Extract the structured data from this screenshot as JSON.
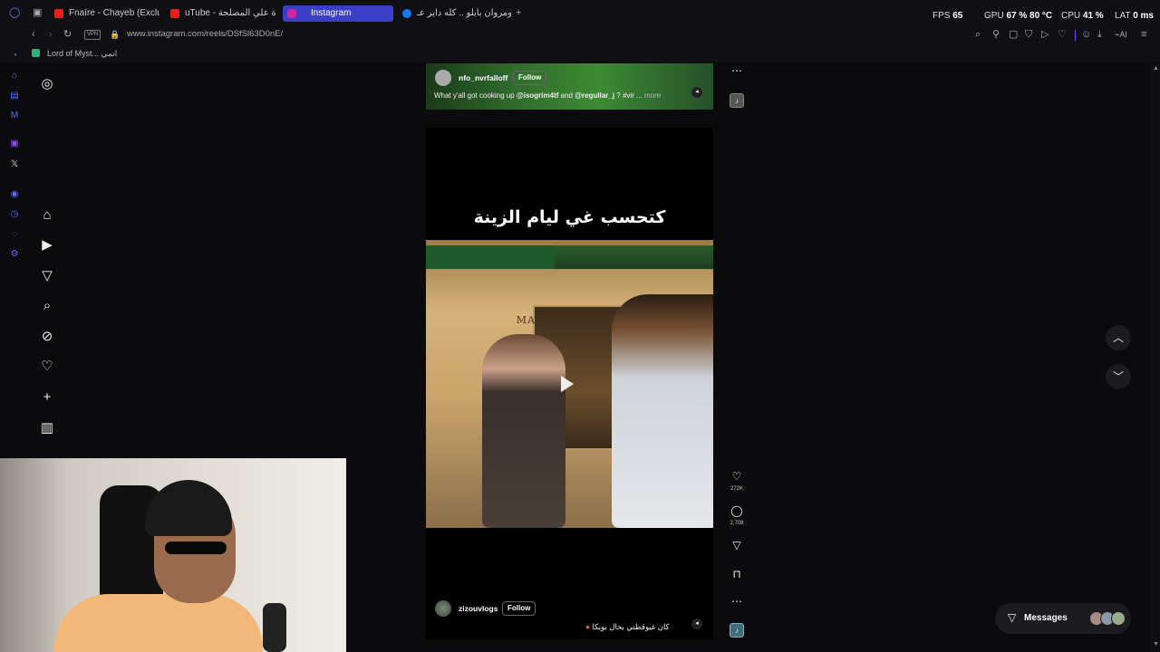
{
  "tabs": [
    {
      "label": "Fnaïre - Chayeb (Exclusive",
      "active": false
    },
    {
      "label": "uTube - دايرة علي المصلحة",
      "active": false
    },
    {
      "label": "Instagram",
      "active": true
    },
    {
      "label": "ويجز ومروان بابلو .. كله داير عـ",
      "active": false
    }
  ],
  "perf": {
    "fps_label": "FPS",
    "fps_value": "65",
    "gpu_label": "GPU",
    "gpu_value": "67 % 80 °C",
    "cpu_label": "CPU",
    "cpu_value": "41 %",
    "lat_label": "LAT",
    "lat_value": "0 ms"
  },
  "address": {
    "vpn": "VPN",
    "url": "www.instagram.com/reels/DSfSl63D0nE/"
  },
  "bookmarks": [
    {
      "label": "Lord of Myst... انمي"
    }
  ],
  "reel_top": {
    "username": "nfo_nvrfalloff",
    "follow_label": "Follow",
    "caption_prefix": "What y'all got cooking up",
    "mention1": "@isogrim4tf",
    "caption_and": "and",
    "mention2": "@regullar_j",
    "caption_tail": "? #vir ...",
    "more_label": "more"
  },
  "reel_main": {
    "overlay_title": "كتحسب غي ليام الزينة",
    "store_sign": "MARINA RINALDI",
    "username": "zizouvlogs",
    "follow_label": "Follow",
    "caption": "كان غيوقطني بحال بوبكا",
    "likes": "272K",
    "comments": "2,708"
  },
  "messages": {
    "label": "Messages"
  },
  "colors": {
    "accent_tab": "#3b3fc7",
    "background": "#0b0b0d",
    "side_icons": "#5a6cff"
  }
}
